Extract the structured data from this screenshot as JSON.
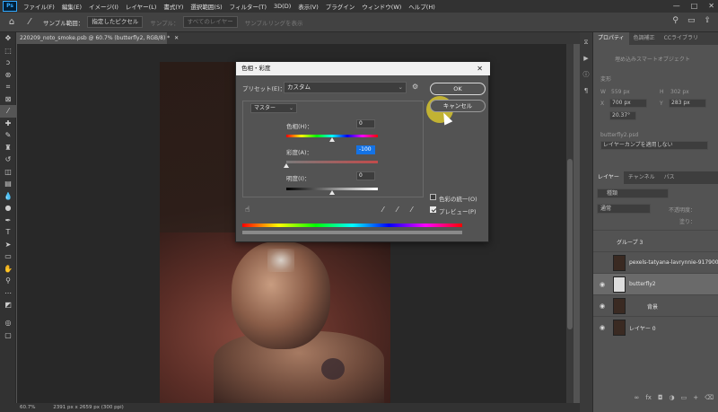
{
  "app": {
    "logo": "Ps"
  },
  "menu": [
    "ファイル(F)",
    "編集(E)",
    "イメージ(I)",
    "レイヤー(L)",
    "書式(Y)",
    "選択範囲(S)",
    "フィルター(T)",
    "3D(D)",
    "表示(V)",
    "プラグイン",
    "ウィンドウ(W)",
    "ヘルプ(H)"
  ],
  "window_controls": {
    "minimize": "—",
    "maximize": "□",
    "close": "✕"
  },
  "options": {
    "sample_label": "サンプル範囲：",
    "sample_value": "指定したピクセル",
    "sample2_label": "サンプル：",
    "sample2_value": "すべてのレイヤー",
    "ring_label": "サンプルリングを表示"
  },
  "document_tab": {
    "title": "220209_noto_smoke.psb @ 60.7% (butterfly2, RGB/8) *",
    "close": "✕"
  },
  "status": {
    "zoom": "60.7%",
    "size": "2391 px x 2659 px (300 ppi)"
  },
  "dialog": {
    "title": "色相・彩度",
    "close": "✕",
    "preset_label": "プリセット(E)：",
    "preset_value": "カスタム",
    "ok": "OK",
    "cancel": "キャンセル",
    "channel": "マスター",
    "hue_label": "色相(H)：",
    "hue_value": "0",
    "sat_label": "彩度(A)：",
    "sat_value": "-100",
    "light_label": "明度(I)：",
    "light_value": "0",
    "colorize_label": "色彩の統一(O)",
    "preview_label": "プレビュー(P)",
    "colorize_checked": false,
    "preview_checked": true
  },
  "properties": {
    "tabs": [
      "プロパティ",
      "色調補正",
      "CCライブラリ"
    ],
    "type": "埋め込みスマートオブジェクト",
    "transform_label": "変形",
    "w_label": "W",
    "w": "559 px",
    "h_label": "H",
    "h": "302 px",
    "x_label": "X",
    "x": "700 px",
    "y_label": "Y",
    "y": "283 px",
    "angle": "20.37°",
    "file": "butterfly2.psd",
    "comp": "レイヤーカンプを適用しない"
  },
  "layers_panel": {
    "tabs": [
      "レイヤー",
      "チャンネル",
      "パス"
    ],
    "search": "種類",
    "blend": "通常",
    "opacity_label": "不透明度：",
    "fill_label": "塗り：",
    "layers": [
      {
        "name": "グループ 3",
        "visible": false
      },
      {
        "name": "pexels-tatyana-lavrynnie-917900",
        "visible": false
      },
      {
        "name": "butterfly2",
        "visible": true
      },
      {
        "name": "背景",
        "visible": true
      },
      {
        "name": "レイヤー 0",
        "visible": true
      }
    ]
  },
  "colors": {
    "accent": "#1473e6",
    "highlight": "#e6d228",
    "panel": "#535353",
    "dark": "#323232"
  }
}
